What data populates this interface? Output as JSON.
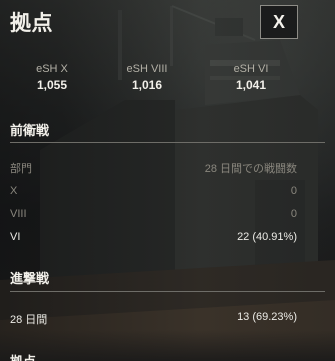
{
  "header": {
    "title": "拠点",
    "close_label": "X"
  },
  "tiers": [
    {
      "name": "eSH X",
      "value": "1,055"
    },
    {
      "name": "eSH VIII",
      "value": "1,016"
    },
    {
      "name": "eSH VI",
      "value": "1,041"
    }
  ],
  "defense": {
    "heading": "前衛戦",
    "col_header_left": "部門",
    "col_header_right": "28 日間での戦闘数",
    "rows": [
      {
        "label": "X",
        "value": "0"
      },
      {
        "label": "VIII",
        "value": "0"
      },
      {
        "label": "VI",
        "value": "22 (40.91%)"
      }
    ]
  },
  "assault": {
    "heading": "進撃戦",
    "rows": [
      {
        "label": "28 日間",
        "value": "13 (69.23%)"
      }
    ]
  },
  "next_section": {
    "heading": "拠点"
  }
}
